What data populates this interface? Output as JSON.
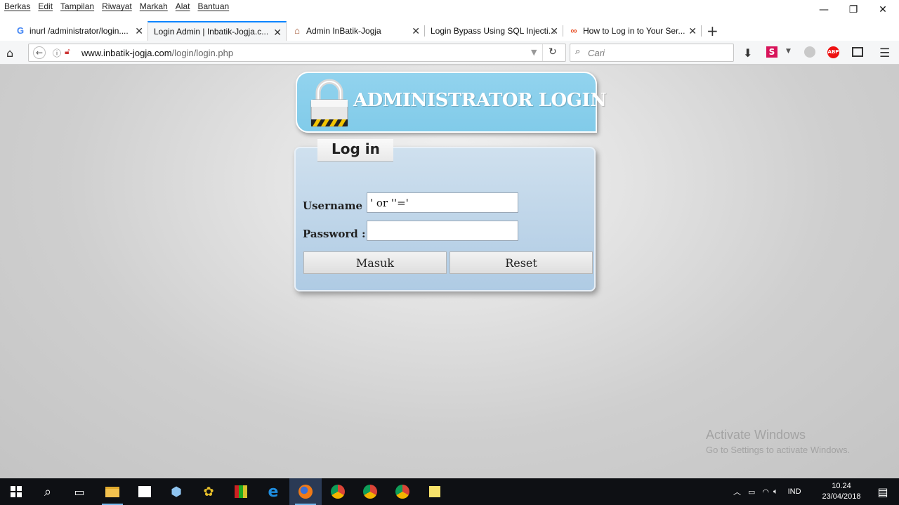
{
  "menubar": {
    "items": [
      "Berkas",
      "Edit",
      "Tampilan",
      "Riwayat",
      "Markah",
      "Alat",
      "Bantuan"
    ]
  },
  "window_controls": {
    "minimize": "—",
    "restore": "❐",
    "close": "✕"
  },
  "tabs": [
    {
      "label": "inurl /administrator/login....",
      "icon": "google-icon"
    },
    {
      "label": "Login Admin | Inbatik-Jogja.c...",
      "icon": "none",
      "active": true
    },
    {
      "label": "Admin InBatik-Jogja",
      "icon": "batik-icon"
    },
    {
      "label": "Login Bypass Using SQL Injecti...",
      "icon": "none"
    },
    {
      "label": "How to Log in to Your Ser...",
      "icon": "link-icon"
    }
  ],
  "new_tab_symbol": "+",
  "navbar": {
    "url_domain": "www.inbatik-jogja.com",
    "url_path": "/login/login.php",
    "search_placeholder": "Cari"
  },
  "page": {
    "banner_title": "ADMINISTRATOR LOGIN",
    "panel_title": "Log in",
    "username_label": "Username :",
    "username_value": "' or ''='",
    "password_label": "Password :",
    "password_value": "",
    "submit_label": "Masuk",
    "reset_label": "Reset"
  },
  "watermark": {
    "line1": "Activate Windows",
    "line2": "Go to Settings to activate Windows."
  },
  "taskbar": {
    "language": "IND",
    "time": "10.24",
    "date": "23/04/2018"
  },
  "colors": {
    "banner": "#86cdeb",
    "panel": "#bdd4e8",
    "taskbar": "#0e1014",
    "active_tab_accent": "#0a84ff"
  }
}
